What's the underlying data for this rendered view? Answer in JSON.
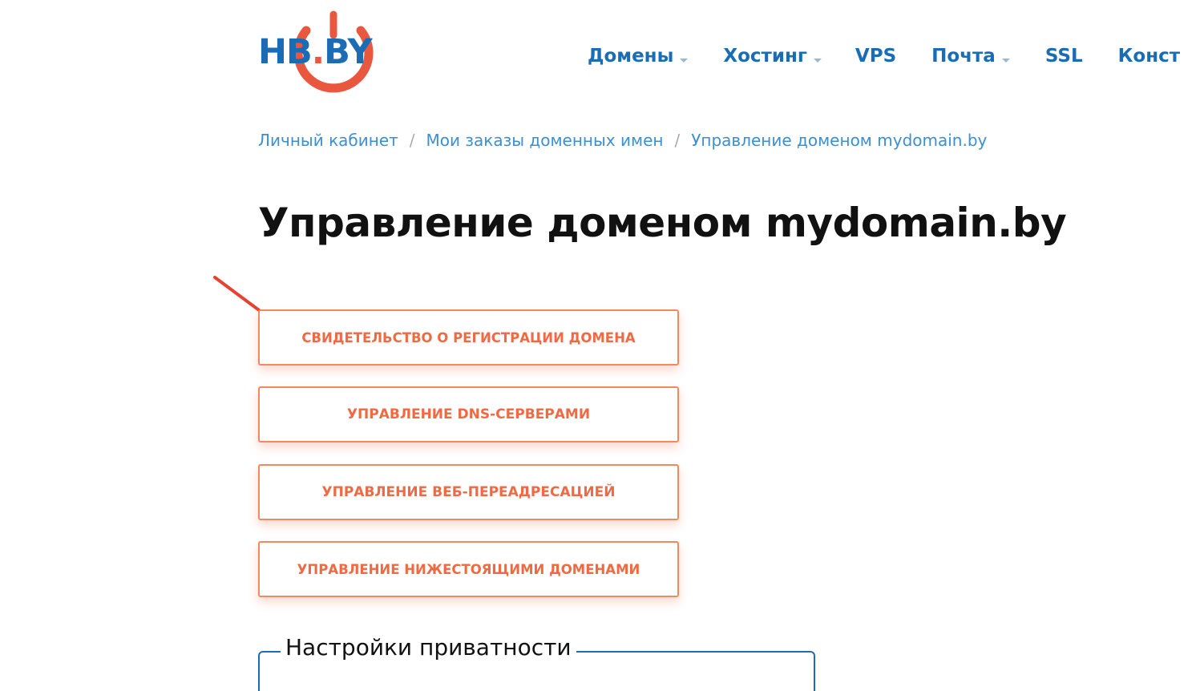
{
  "logo": {
    "text_main": "HB",
    "text_dot": ".",
    "text_tail": "BY",
    "color_blue": "#1a6db4",
    "color_red": "#e9573f",
    "icon": "power-icon"
  },
  "nav": {
    "items": [
      {
        "label": "Домены",
        "has_dropdown": true
      },
      {
        "label": "Хостинг",
        "has_dropdown": true
      },
      {
        "label": "VPS",
        "has_dropdown": false
      },
      {
        "label": "Почта",
        "has_dropdown": true
      },
      {
        "label": "SSL",
        "has_dropdown": false
      },
      {
        "label": "Конст",
        "has_dropdown": false
      }
    ]
  },
  "breadcrumb": {
    "items": [
      {
        "label": "Личный кабинет"
      },
      {
        "label": "Мои заказы доменных имен"
      },
      {
        "label": "Управление доменом mydomain.by"
      }
    ],
    "separator": "/"
  },
  "page": {
    "title": "Управление доменом mydomain.by"
  },
  "actions": {
    "buttons": [
      {
        "label": "СВИДЕТЕЛЬСТВО О РЕГИСТРАЦИИ ДОМЕНА"
      },
      {
        "label": "УПРАВЛЕНИЕ DNS-СЕРВЕРАМИ"
      },
      {
        "label": "УПРАВЛЕНИЕ ВЕБ-ПЕРЕАДРЕСАЦИЕЙ"
      },
      {
        "label": "УПРАВЛЕНИЕ НИЖЕСТОЯЩИМИ ДОМЕНАМИ"
      }
    ],
    "accent_color": "#ef6a43"
  },
  "privacy": {
    "legend": "Настройки приватности"
  },
  "annotation": {
    "arrow_color": "#e8412f",
    "icon": "arrow-annotation-icon"
  }
}
